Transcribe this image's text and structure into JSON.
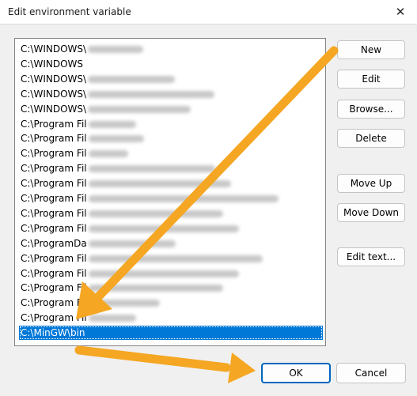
{
  "window": {
    "title": "Edit environment variable",
    "close_glyph": "✕"
  },
  "path_list": {
    "items": [
      {
        "label": "C:\\WINDOWS\\",
        "blur": 70
      },
      {
        "label": "C:\\WINDOWS",
        "blur": 0
      },
      {
        "label": "C:\\WINDOWS\\",
        "blur": 110
      },
      {
        "label": "C:\\WINDOWS\\",
        "blur": 160
      },
      {
        "label": "C:\\WINDOWS\\",
        "blur": 130
      },
      {
        "label": "C:\\Program Fil",
        "blur": 60
      },
      {
        "label": "C:\\Program Fil",
        "blur": 70
      },
      {
        "label": "C:\\Program Fil",
        "blur": 50
      },
      {
        "label": "C:\\Program Fil",
        "blur": 160
      },
      {
        "label": "C:\\Program Fil",
        "blur": 180
      },
      {
        "label": "C:\\Program Fil",
        "blur": 240
      },
      {
        "label": "C:\\Program Fil",
        "blur": 170
      },
      {
        "label": "C:\\Program Fil",
        "blur": 190
      },
      {
        "label": "C:\\ProgramDa",
        "blur": 110
      },
      {
        "label": "C:\\Program Fil",
        "blur": 220
      },
      {
        "label": "C:\\Program Fil",
        "blur": 190
      },
      {
        "label": "C:\\Program Fil",
        "blur": 170
      },
      {
        "label": "C:\\Program Fil",
        "blur": 90
      },
      {
        "label": "C:\\Program Fil",
        "blur": 60
      },
      {
        "label": "C:\\MinGW\\bin",
        "blur": 0,
        "selected": true
      }
    ]
  },
  "buttons": {
    "new": "New",
    "edit": "Edit",
    "browse": "Browse...",
    "delete": "Delete",
    "move_up": "Move Up",
    "move_down": "Move Down",
    "edit_text": "Edit text...",
    "ok": "OK",
    "cancel": "Cancel"
  },
  "colors": {
    "selection": "#0078d7",
    "annotation_arrow": "#f5a623",
    "default_button_border": "#0067c0"
  }
}
